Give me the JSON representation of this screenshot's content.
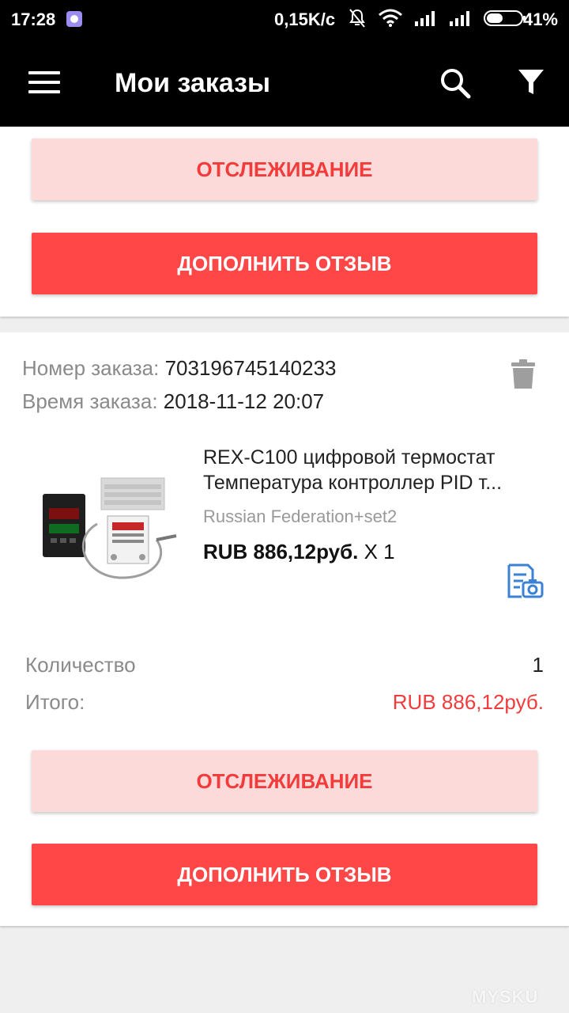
{
  "status_bar": {
    "time": "17:28",
    "speed": "0,15K/c",
    "battery": "41%"
  },
  "app_bar": {
    "title": "Мои заказы",
    "menu_icon": "menu-icon",
    "search_icon": "search-icon",
    "filter_icon": "filter-icon"
  },
  "card1": {
    "track_label": "ОТСЛЕЖИВАНИЕ",
    "review_label": "ДОПОЛНИТЬ ОТЗЫВ"
  },
  "order": {
    "number_label": "Номер заказа:",
    "number": "703196745140233",
    "time_label": "Время заказа:",
    "time": "2018-11-12 20:07",
    "product": {
      "title_line1": "REX-C100 цифровой термостат",
      "title_line2": "Температура контроллер PID т...",
      "variant": "Russian Federation+set2",
      "price": "RUB 886,12руб.",
      "qty_text": "X 1"
    },
    "quantity_label": "Количество",
    "quantity": "1",
    "total_label": "Итого:",
    "total": "RUB 886,12руб.",
    "track_label": "ОТСЛЕЖИВАНИЕ",
    "review_label": "ДОПОЛНИТЬ ОТЗЫВ"
  },
  "watermark": "MYSKU",
  "colors": {
    "accent_red": "#ff4747",
    "track_bg": "#fddada",
    "text_red": "#f23c3c",
    "snapshot_blue": "#3b82d6"
  }
}
